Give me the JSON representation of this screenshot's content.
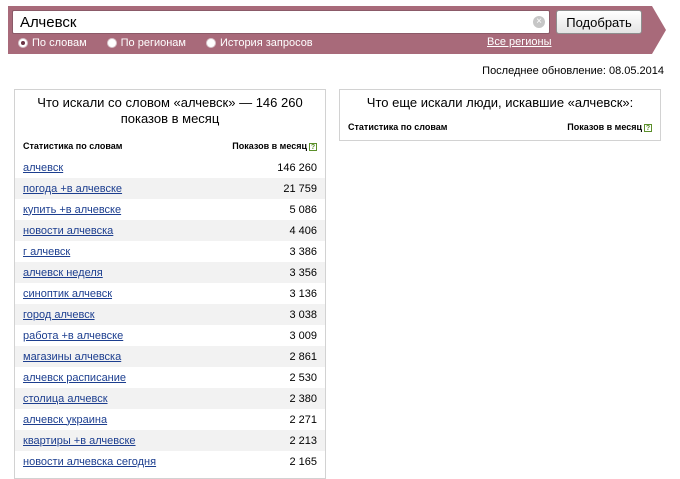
{
  "search": {
    "query": "Алчевск",
    "submit_label": "Подобрать",
    "clear_glyph": "×"
  },
  "modes": [
    {
      "label": "По словам",
      "checked": true
    },
    {
      "label": "По регионам",
      "checked": false
    },
    {
      "label": "История запросов",
      "checked": false
    }
  ],
  "all_regions_label": "Все регионы",
  "updated_text": "Последнее обновление: 08.05.2014",
  "left_panel": {
    "title": "Что искали со словом «алчевск» — 146 260 показов в месяц",
    "col_keyword": "Статистика по словам",
    "col_impressions": "Показов в месяц",
    "help_glyph": "?",
    "rows": [
      {
        "keyword": "алчевск",
        "count": "146 260"
      },
      {
        "keyword": "погода +в алчевске",
        "count": "21 759"
      },
      {
        "keyword": "купить +в алчевске",
        "count": "5 086"
      },
      {
        "keyword": "новости алчевска",
        "count": "4 406"
      },
      {
        "keyword": "г алчевск",
        "count": "3 386"
      },
      {
        "keyword": "алчевск неделя",
        "count": "3 356"
      },
      {
        "keyword": "синоптик алчевск",
        "count": "3 136"
      },
      {
        "keyword": "город алчевск",
        "count": "3 038"
      },
      {
        "keyword": "работа +в алчевске",
        "count": "3 009"
      },
      {
        "keyword": "магазины алчевска",
        "count": "2 861"
      },
      {
        "keyword": "алчевск расписание",
        "count": "2 530"
      },
      {
        "keyword": "столица алчевск",
        "count": "2 380"
      },
      {
        "keyword": "алчевск украина",
        "count": "2 271"
      },
      {
        "keyword": "квартиры +в алчевске",
        "count": "2 213"
      },
      {
        "keyword": "новости алчевска сегодня",
        "count": "2 165"
      }
    ]
  },
  "right_panel": {
    "title": "Что еще искали люди, искавшие «алчевск»:",
    "col_keyword": "Статистика по словам",
    "col_impressions": "Показов в месяц",
    "help_glyph": "?"
  },
  "colors": {
    "band": "#a86a7a",
    "link": "#1c3e8f",
    "row_alt": "#f2f2f2"
  }
}
